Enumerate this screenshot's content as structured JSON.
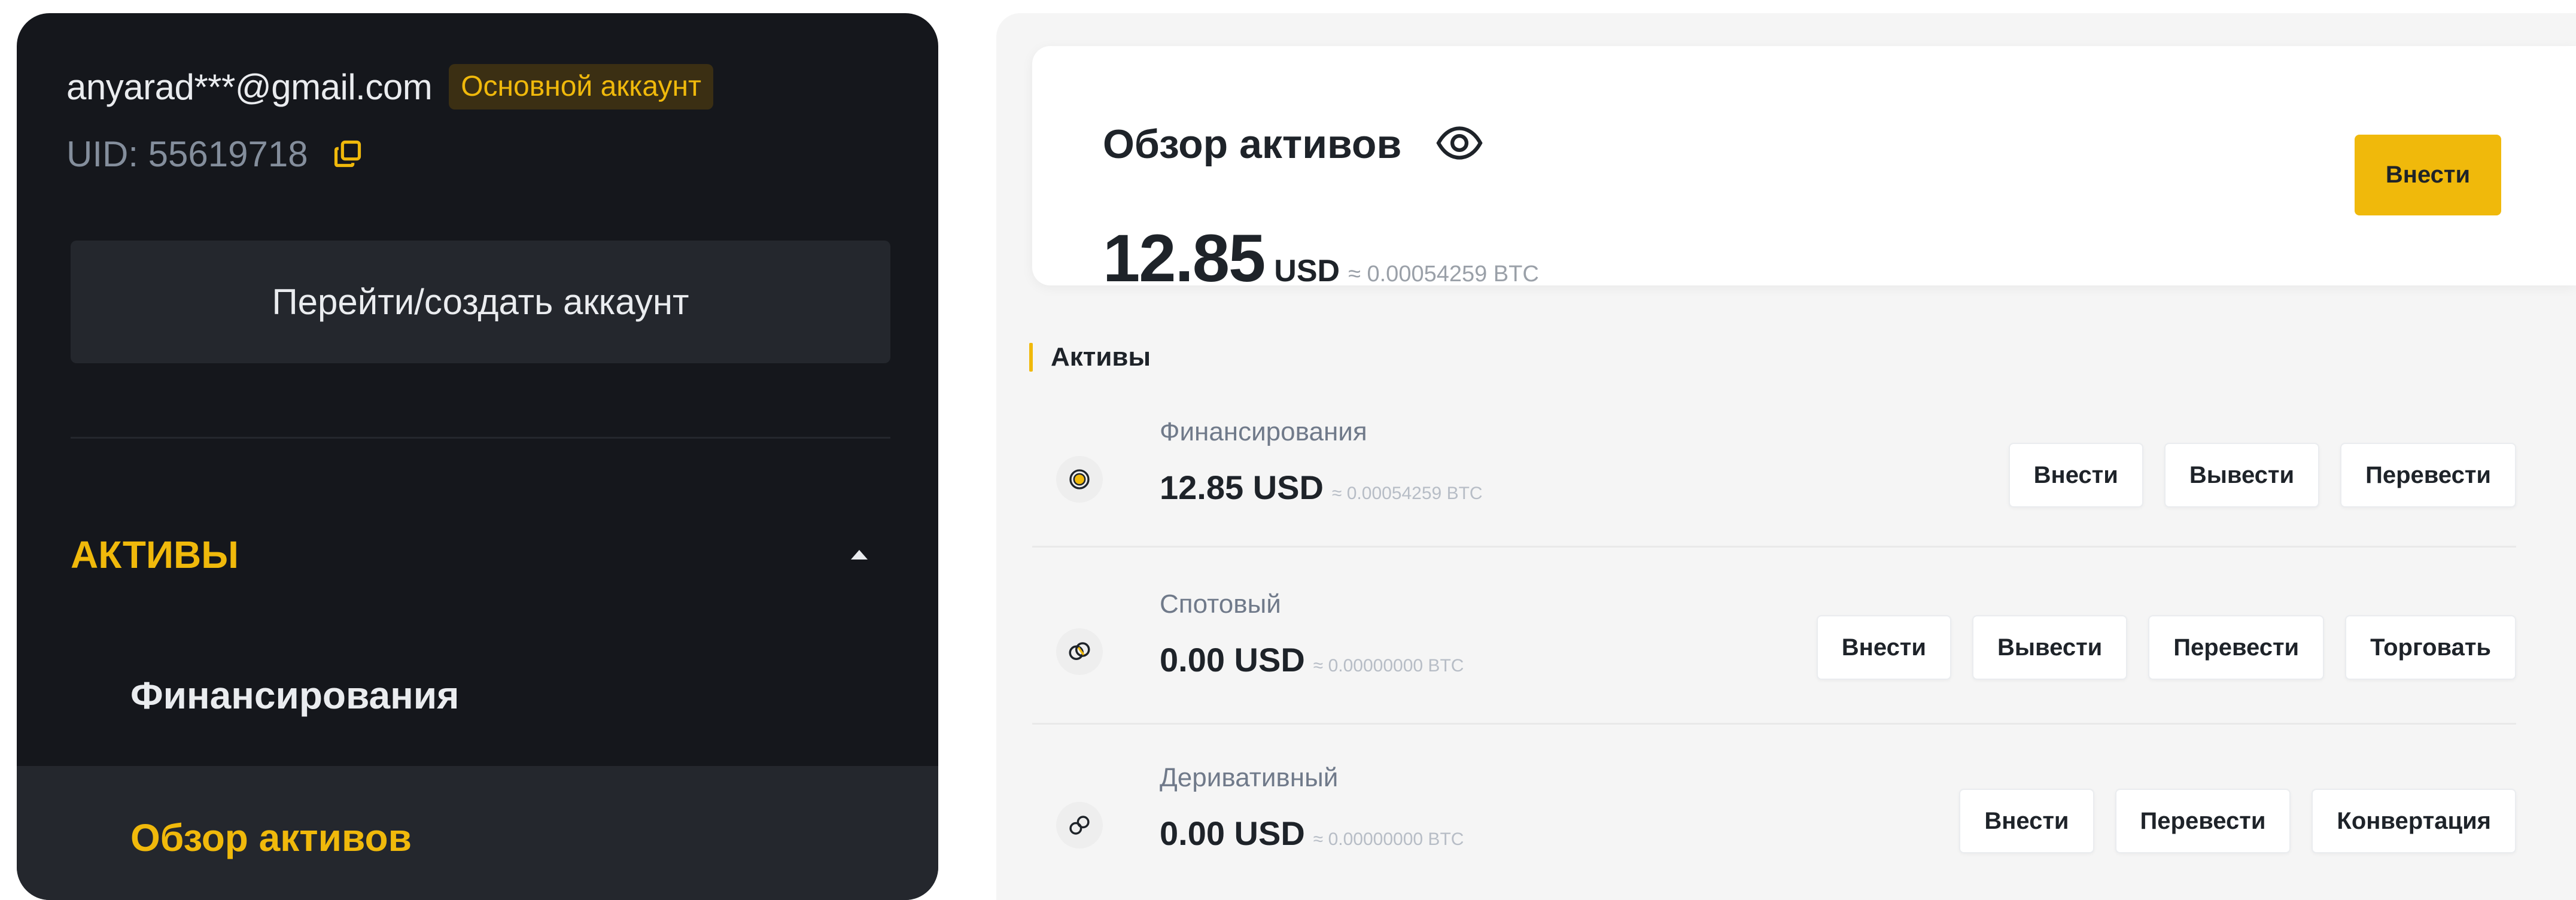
{
  "account": {
    "email": "anyarad***@gmail.com",
    "badge": "Основной аккаунт",
    "uid": "UID: 55619718",
    "switch_label": "Перейти/создать аккаунт"
  },
  "sidebar": {
    "section_title": "АКТИВЫ",
    "items": [
      {
        "label": "Финансирования",
        "active": false
      },
      {
        "label": "Обзор активов",
        "active": true
      }
    ]
  },
  "overview": {
    "title": "Обзор активов",
    "amount": "12.85",
    "currency": "USD",
    "btc_equiv": "≈ 0.00054259 BTC",
    "deposit_label": "Внести"
  },
  "assets": {
    "title": "Активы",
    "rows": [
      {
        "name": "Финансирования",
        "amount": "12.85 USD",
        "btc": "≈ 0.00054259 BTC",
        "buttons": [
          "Внести",
          "Вывести",
          "Перевести"
        ]
      },
      {
        "name": "Спотовый",
        "amount": "0.00 USD",
        "btc": "≈ 0.00000000 BTC",
        "buttons": [
          "Внести",
          "Вывести",
          "Перевести",
          "Торговать"
        ]
      },
      {
        "name": "Деривативный",
        "amount": "0.00 USD",
        "btc": "≈ 0.00000000 BTC",
        "buttons": [
          "Внести",
          "Перевести",
          "Конвертация"
        ]
      }
    ]
  },
  "colors": {
    "accent": "#f0b90b",
    "sidebar_bg": "#15171c",
    "sidebar_surface": "#24272d",
    "text_dark": "#1e2329"
  },
  "icons": {
    "copy": "copy-icon",
    "eye": "eye-icon",
    "caret": "caret-up-icon",
    "funding": "funding-coin-icon",
    "spot": "spot-coin-icon",
    "derivatives": "derivatives-coin-icon"
  }
}
